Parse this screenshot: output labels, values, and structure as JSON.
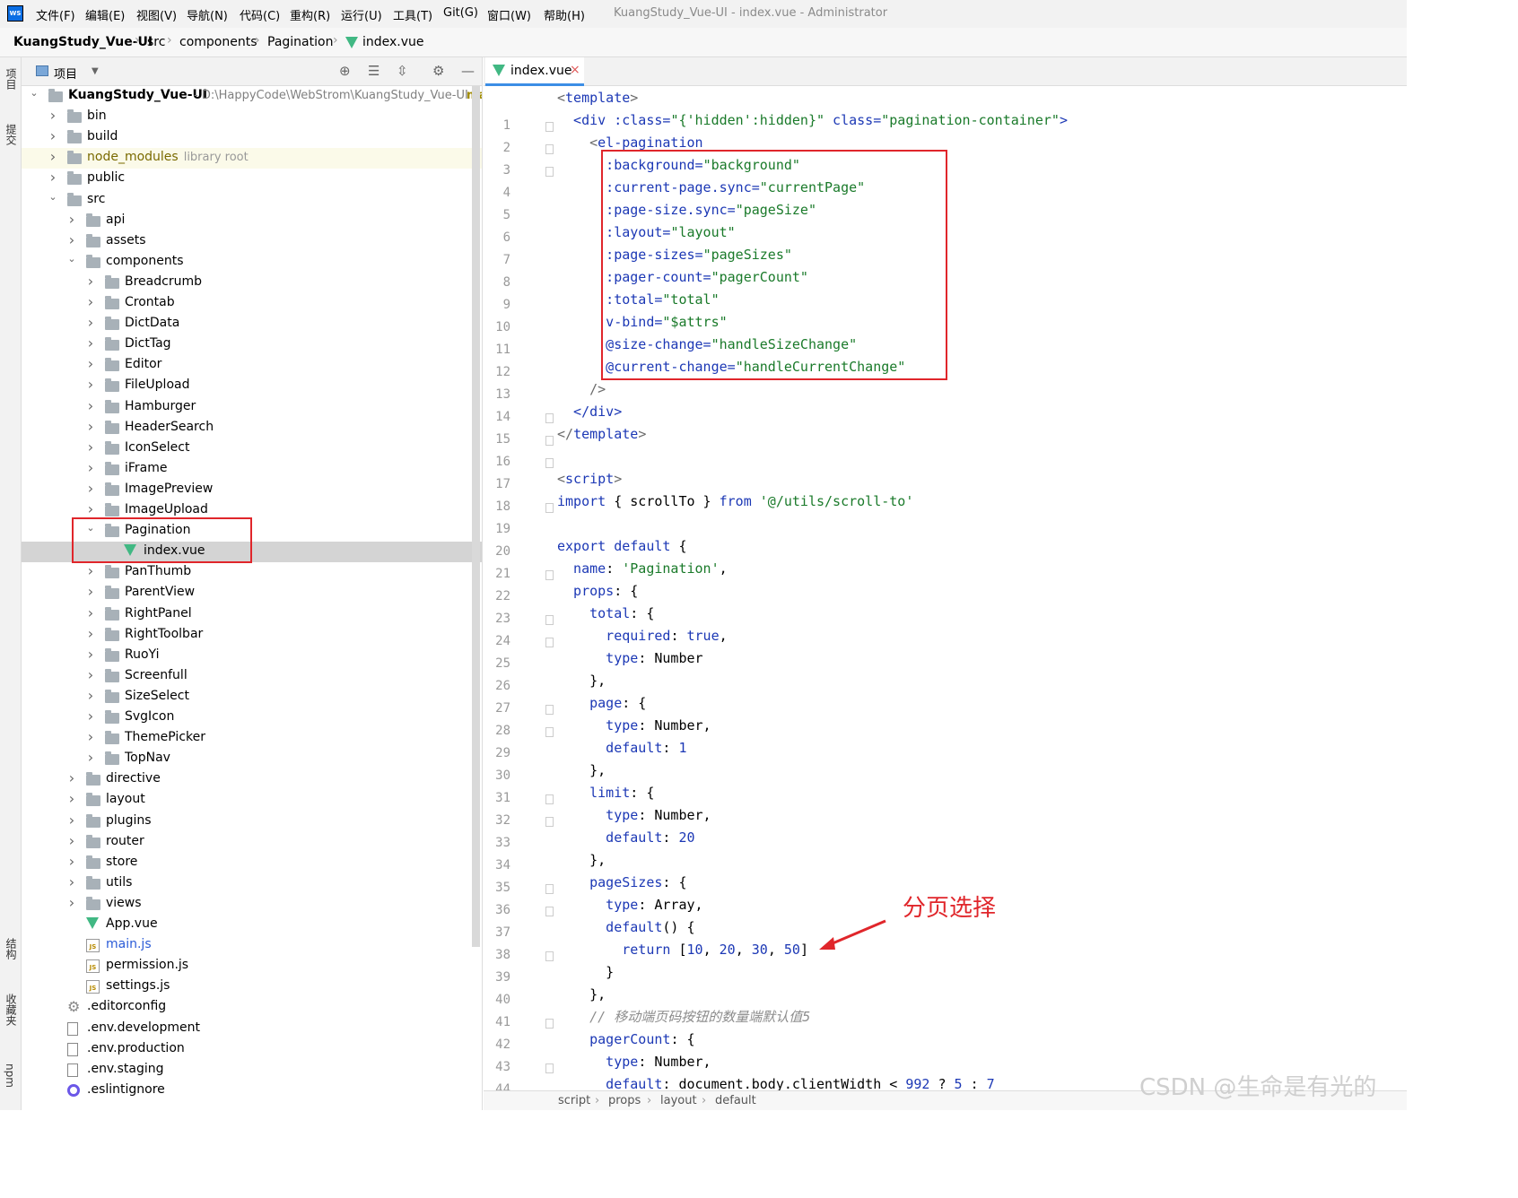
{
  "menu": {
    "items": [
      "文件(F)",
      "编辑(E)",
      "视图(V)",
      "导航(N)",
      "代码(C)",
      "重构(R)",
      "运行(U)",
      "工具(T)",
      "Git(G)",
      "窗口(W)",
      "帮助(H)"
    ],
    "window_title": "KuangStudy_Vue-UI - index.vue - Administrator"
  },
  "breadcrumb": [
    "KuangStudy_Vue-UI",
    "src",
    "components",
    "Pagination",
    "index.vue"
  ],
  "left_strip": {
    "project": "项目",
    "commit": "提交",
    "structure": "结构",
    "favorites": "收藏夹",
    "npm": "npm"
  },
  "project_panel": {
    "title": "项目"
  },
  "tree": [
    {
      "label": "KuangStudy_Vue-UI",
      "path": "- D:\\HappyCode\\WebStrom\\KuangStudy_Vue-UI",
      "extra": "ma",
      "type": "folder",
      "indent": 0,
      "arrow": "down",
      "bold": true
    },
    {
      "label": "bin",
      "type": "folder",
      "indent": 1,
      "arrow": "right"
    },
    {
      "label": "build",
      "type": "folder",
      "indent": 1,
      "arrow": "right"
    },
    {
      "label": "node_modules",
      "type": "folder",
      "indent": 1,
      "arrow": "right",
      "lib": "library root",
      "highlight": true
    },
    {
      "label": "public",
      "type": "folder",
      "indent": 1,
      "arrow": "right"
    },
    {
      "label": "src",
      "type": "folder",
      "indent": 1,
      "arrow": "down"
    },
    {
      "label": "api",
      "type": "folder",
      "indent": 2,
      "arrow": "right"
    },
    {
      "label": "assets",
      "type": "folder",
      "indent": 2,
      "arrow": "right"
    },
    {
      "label": "components",
      "type": "folder",
      "indent": 2,
      "arrow": "down"
    },
    {
      "label": "Breadcrumb",
      "type": "folder",
      "indent": 3,
      "arrow": "right"
    },
    {
      "label": "Crontab",
      "type": "folder",
      "indent": 3,
      "arrow": "right"
    },
    {
      "label": "DictData",
      "type": "folder",
      "indent": 3,
      "arrow": "right"
    },
    {
      "label": "DictTag",
      "type": "folder",
      "indent": 3,
      "arrow": "right"
    },
    {
      "label": "Editor",
      "type": "folder",
      "indent": 3,
      "arrow": "right"
    },
    {
      "label": "FileUpload",
      "type": "folder",
      "indent": 3,
      "arrow": "right"
    },
    {
      "label": "Hamburger",
      "type": "folder",
      "indent": 3,
      "arrow": "right"
    },
    {
      "label": "HeaderSearch",
      "type": "folder",
      "indent": 3,
      "arrow": "right"
    },
    {
      "label": "IconSelect",
      "type": "folder",
      "indent": 3,
      "arrow": "right"
    },
    {
      "label": "iFrame",
      "type": "folder",
      "indent": 3,
      "arrow": "right"
    },
    {
      "label": "ImagePreview",
      "type": "folder",
      "indent": 3,
      "arrow": "right"
    },
    {
      "label": "ImageUpload",
      "type": "folder",
      "indent": 3,
      "arrow": "right"
    },
    {
      "label": "Pagination",
      "type": "folder",
      "indent": 3,
      "arrow": "down"
    },
    {
      "label": "index.vue",
      "type": "vue",
      "indent": 4,
      "arrow": "",
      "selected": true
    },
    {
      "label": "PanThumb",
      "type": "folder",
      "indent": 3,
      "arrow": "right"
    },
    {
      "label": "ParentView",
      "type": "folder",
      "indent": 3,
      "arrow": "right"
    },
    {
      "label": "RightPanel",
      "type": "folder",
      "indent": 3,
      "arrow": "right"
    },
    {
      "label": "RightToolbar",
      "type": "folder",
      "indent": 3,
      "arrow": "right"
    },
    {
      "label": "RuoYi",
      "type": "folder",
      "indent": 3,
      "arrow": "right"
    },
    {
      "label": "Screenfull",
      "type": "folder",
      "indent": 3,
      "arrow": "right"
    },
    {
      "label": "SizeSelect",
      "type": "folder",
      "indent": 3,
      "arrow": "right"
    },
    {
      "label": "SvgIcon",
      "type": "folder",
      "indent": 3,
      "arrow": "right"
    },
    {
      "label": "ThemePicker",
      "type": "folder",
      "indent": 3,
      "arrow": "right"
    },
    {
      "label": "TopNav",
      "type": "folder",
      "indent": 3,
      "arrow": "right"
    },
    {
      "label": "directive",
      "type": "folder",
      "indent": 2,
      "arrow": "right"
    },
    {
      "label": "layout",
      "type": "folder",
      "indent": 2,
      "arrow": "right"
    },
    {
      "label": "plugins",
      "type": "folder",
      "indent": 2,
      "arrow": "right"
    },
    {
      "label": "router",
      "type": "folder",
      "indent": 2,
      "arrow": "right"
    },
    {
      "label": "store",
      "type": "folder",
      "indent": 2,
      "arrow": "right"
    },
    {
      "label": "utils",
      "type": "folder",
      "indent": 2,
      "arrow": "right"
    },
    {
      "label": "views",
      "type": "folder",
      "indent": 2,
      "arrow": "right"
    },
    {
      "label": "App.vue",
      "type": "vue",
      "indent": 2,
      "arrow": ""
    },
    {
      "label": "main.js",
      "type": "js",
      "indent": 2,
      "arrow": "",
      "color": "#2a5bd7"
    },
    {
      "label": "permission.js",
      "type": "js",
      "indent": 2,
      "arrow": ""
    },
    {
      "label": "settings.js",
      "type": "js",
      "indent": 2,
      "arrow": ""
    },
    {
      "label": ".editorconfig",
      "type": "gear",
      "indent": 1,
      "arrow": ""
    },
    {
      "label": ".env.development",
      "type": "file",
      "indent": 1,
      "arrow": ""
    },
    {
      "label": ".env.production",
      "type": "file",
      "indent": 1,
      "arrow": ""
    },
    {
      "label": ".env.staging",
      "type": "file",
      "indent": 1,
      "arrow": ""
    },
    {
      "label": ".eslintignore",
      "type": "ring",
      "indent": 1,
      "arrow": ""
    }
  ],
  "editor": {
    "tab_label": "index.vue",
    "lines": [
      [
        [
          "<",
          "#6a6a6a"
        ],
        [
          "template",
          "#1c38b5"
        ],
        [
          ">",
          "#6a6a6a"
        ]
      ],
      [
        [
          "  <div ",
          "#1c38b5"
        ],
        [
          ":class=",
          "#1c38b5"
        ],
        [
          "\"{'hidden':hidden}\"",
          "#1a7a2a"
        ],
        [
          " class=",
          "#1c38b5"
        ],
        [
          "\"pagination-container\"",
          "#1a7a2a"
        ],
        [
          ">",
          "#1c38b5"
        ]
      ],
      [
        [
          "    <",
          "#6a6a6a"
        ],
        [
          "el-pagination",
          "#1c38b5"
        ]
      ],
      [
        [
          "      :background=",
          "#1c38b5"
        ],
        [
          "\"background\"",
          "#1a7a2a"
        ]
      ],
      [
        [
          "      :current-page.sync=",
          "#1c38b5"
        ],
        [
          "\"currentPage\"",
          "#1a7a2a"
        ]
      ],
      [
        [
          "      :page-size.sync=",
          "#1c38b5"
        ],
        [
          "\"pageSize\"",
          "#1a7a2a"
        ]
      ],
      [
        [
          "      :layout=",
          "#1c38b5"
        ],
        [
          "\"layout\"",
          "#1a7a2a"
        ]
      ],
      [
        [
          "      :page-sizes=",
          "#1c38b5"
        ],
        [
          "\"pageSizes\"",
          "#1a7a2a"
        ]
      ],
      [
        [
          "      :pager-count=",
          "#1c38b5"
        ],
        [
          "\"pagerCount\"",
          "#1a7a2a"
        ]
      ],
      [
        [
          "      :total=",
          "#1c38b5"
        ],
        [
          "\"total\"",
          "#1a7a2a"
        ]
      ],
      [
        [
          "      v-bind=",
          "#1c38b5"
        ],
        [
          "\"$attrs\"",
          "#1a7a2a"
        ]
      ],
      [
        [
          "      @size-change=",
          "#1c38b5"
        ],
        [
          "\"handleSizeChange\"",
          "#1a7a2a"
        ]
      ],
      [
        [
          "      @current-change=",
          "#1c38b5"
        ],
        [
          "\"handleCurrentChange\"",
          "#1a7a2a"
        ]
      ],
      [
        [
          "    />",
          "#6a6a6a"
        ]
      ],
      [
        [
          "  </div>",
          "#1c38b5"
        ]
      ],
      [
        [
          "</",
          "#6a6a6a"
        ],
        [
          "template",
          "#1c38b5"
        ],
        [
          ">",
          "#6a6a6a"
        ]
      ],
      [
        [
          "",
          "#000"
        ]
      ],
      [
        [
          "<",
          "#6a6a6a"
        ],
        [
          "script",
          "#1c38b5"
        ],
        [
          ">",
          "#6a6a6a"
        ]
      ],
      [
        [
          "import",
          "#1c38b5"
        ],
        [
          " { ",
          "#000"
        ],
        [
          "scrollTo",
          "#000"
        ],
        [
          " } ",
          "#000"
        ],
        [
          "from",
          "#1c38b5"
        ],
        [
          " '@/utils/scroll-to'",
          "#1a7a2a"
        ]
      ],
      [
        [
          "",
          "#000"
        ]
      ],
      [
        [
          "export default",
          "#1c38b5"
        ],
        [
          " {",
          "#000"
        ]
      ],
      [
        [
          "  name",
          "#1c38b5"
        ],
        [
          ": ",
          "#000"
        ],
        [
          "'Pagination'",
          "#1a7a2a"
        ],
        [
          ",",
          "#000"
        ]
      ],
      [
        [
          "  props",
          "#1c38b5"
        ],
        [
          ": {",
          "#000"
        ]
      ],
      [
        [
          "    total",
          "#1c38b5"
        ],
        [
          ": {",
          "#000"
        ]
      ],
      [
        [
          "      required",
          "#1c38b5"
        ],
        [
          ": ",
          "#000"
        ],
        [
          "true",
          "#1c38b5"
        ],
        [
          ",",
          "#000"
        ]
      ],
      [
        [
          "      type",
          "#1c38b5"
        ],
        [
          ": Number",
          "#000"
        ]
      ],
      [
        [
          "    },",
          "#000"
        ]
      ],
      [
        [
          "    page",
          "#1c38b5"
        ],
        [
          ": {",
          "#000"
        ]
      ],
      [
        [
          "      type",
          "#1c38b5"
        ],
        [
          ": Number,",
          "#000"
        ]
      ],
      [
        [
          "      default",
          "#1c38b5"
        ],
        [
          ": ",
          "#000"
        ],
        [
          "1",
          "#1c38b5"
        ]
      ],
      [
        [
          "    },",
          "#000"
        ]
      ],
      [
        [
          "    limit",
          "#1c38b5"
        ],
        [
          ": {",
          "#000"
        ]
      ],
      [
        [
          "      type",
          "#1c38b5"
        ],
        [
          ": Number,",
          "#000"
        ]
      ],
      [
        [
          "      default",
          "#1c38b5"
        ],
        [
          ": ",
          "#000"
        ],
        [
          "20",
          "#1c38b5"
        ]
      ],
      [
        [
          "    },",
          "#000"
        ]
      ],
      [
        [
          "    pageSizes",
          "#1c38b5"
        ],
        [
          ": {",
          "#000"
        ]
      ],
      [
        [
          "      type",
          "#1c38b5"
        ],
        [
          ": Array,",
          "#000"
        ]
      ],
      [
        [
          "      default",
          "#1c38b5"
        ],
        [
          "() {",
          "#000"
        ]
      ],
      [
        [
          "        return",
          "#1c38b5"
        ],
        [
          " [",
          "#000"
        ],
        [
          "10",
          "#1c38b5"
        ],
        [
          ", ",
          "#000"
        ],
        [
          "20",
          "#1c38b5"
        ],
        [
          ", ",
          "#000"
        ],
        [
          "30",
          "#1c38b5"
        ],
        [
          ", ",
          "#000"
        ],
        [
          "50",
          "#1c38b5"
        ],
        [
          "]",
          "#000"
        ]
      ],
      [
        [
          "      }",
          "#000"
        ]
      ],
      [
        [
          "    },",
          "#000"
        ]
      ],
      [
        [
          "    // 移动端页码按钮的数量端默认值5",
          "#8c8c8c"
        ]
      ],
      [
        [
          "    pagerCount",
          "#1c38b5"
        ],
        [
          ": {",
          "#000"
        ]
      ],
      [
        [
          "      type",
          "#1c38b5"
        ],
        [
          ": Number,",
          "#000"
        ]
      ],
      [
        [
          "      default",
          "#1c38b5"
        ],
        [
          ": document.body.clientWidth < ",
          "#000"
        ],
        [
          "992",
          "#1c38b5"
        ],
        [
          " ? ",
          "#000"
        ],
        [
          "5",
          "#1c38b5"
        ],
        [
          " : ",
          "#000"
        ],
        [
          "7",
          "#1c38b5"
        ]
      ]
    ]
  },
  "annotation": "分页选择",
  "bottom_breadcrumb": [
    "script",
    "props",
    "layout",
    "default"
  ],
  "watermark": "CSDN @生命是有光的"
}
